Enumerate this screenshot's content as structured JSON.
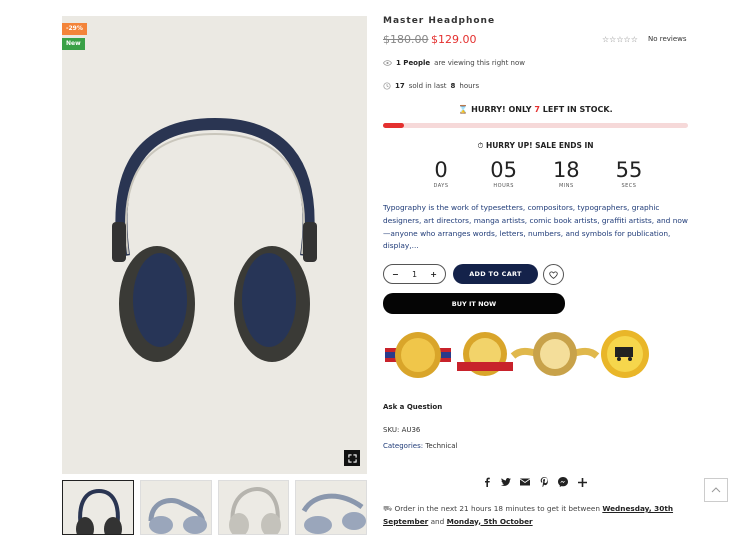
{
  "gallery": {
    "badge_sale": "-29%",
    "badge_new": "New"
  },
  "product": {
    "title": "Master Headphone",
    "price_old": "$180.00",
    "price_new": "$129.00",
    "reviews_label": "No reviews",
    "viewing_count": "1 People",
    "viewing_text": "are viewing this right now",
    "sold_count": "17",
    "sold_text_1": "sold in last",
    "sold_hours": "8",
    "sold_text_2": "hours"
  },
  "stock": {
    "prefix": "HURRY! ONLY",
    "count": "7",
    "suffix": "LEFT IN STOCK.",
    "level": 0.07
  },
  "countdown": {
    "heading": "HURRY UP! SALE ENDS IN",
    "days": "0",
    "days_label": "DAYS",
    "hours": "05",
    "hours_label": "HOURS",
    "mins": "18",
    "mins_label": "MINS",
    "secs": "55",
    "secs_label": "SECS"
  },
  "description": "Typography is the work of typesetters, compositors, typographers, graphic designers, art directors, manga artists, comic book artists, graffiti artists, and now—anyone who arranges words, letters, numbers, and symbols for publication, display,...",
  "cart": {
    "qty": "1",
    "add_to_cart": "ADD TO CART",
    "buy_now": "BUY IT NOW"
  },
  "links": {
    "ask": "Ask a Question",
    "sku_label": "SKU:",
    "sku_value": "AU36",
    "categories_label": "Categories:",
    "categories_value": "Technical"
  },
  "delivery": {
    "text_1": "Order in the next",
    "countdown": "21 hours 18 minutes",
    "text_2": "to get it between",
    "date_1": "Wednesday, 30th September",
    "text_3": "and",
    "date_2": "Monday, 5th October"
  },
  "colors": {
    "accent": "#e4302f",
    "navy": "#14224a",
    "link": "#1f3b78"
  }
}
